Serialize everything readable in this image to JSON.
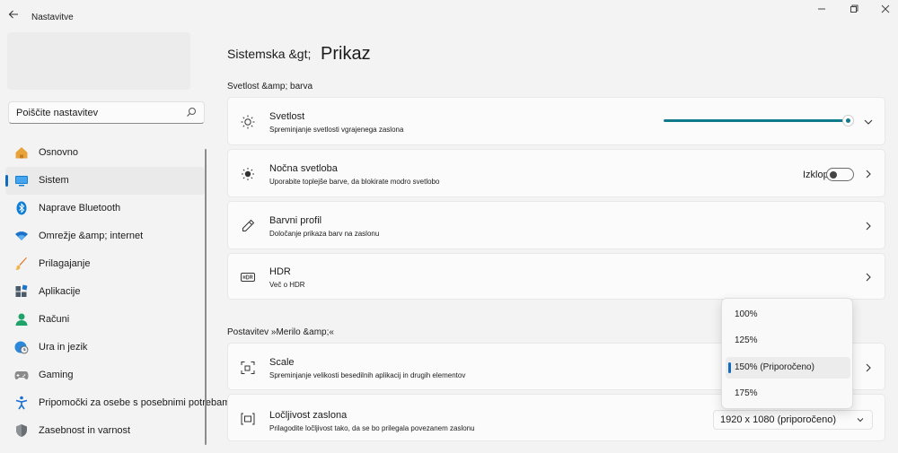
{
  "window": {
    "title": "Nastavitve",
    "back_icon": "arrow-left-icon",
    "minimize_icon": "minimize-icon",
    "maximize_icon": "restore-icon",
    "close_icon": "close-icon"
  },
  "search": {
    "placeholder": "Poiščite nastavitev",
    "icon": "search-icon"
  },
  "sidebar": {
    "items": [
      {
        "label": "Osnovno",
        "icon": "home-icon",
        "color": "#e8a33b"
      },
      {
        "label": "Sistem",
        "icon": "monitor-icon",
        "color": "#0f7fd6",
        "active": true
      },
      {
        "label": "Naprave Bluetooth",
        "icon": "bluetooth-icon",
        "color": "#0f7fd6"
      },
      {
        "label": "Omrežje &amp; internet",
        "icon": "wifi-icon",
        "color": "#1a73c9"
      },
      {
        "label": "Prilagajanje",
        "icon": "brush-icon",
        "color": "#e07b2f"
      },
      {
        "label": "Aplikacije",
        "icon": "apps-icon",
        "color": "#4a5a6a"
      },
      {
        "label": "Računi",
        "icon": "person-icon",
        "color": "#1fa36b"
      },
      {
        "label": "Ura in jezik",
        "icon": "globe-clock-icon",
        "color": "#2b88d8"
      },
      {
        "label": "Gaming",
        "icon": "gamepad-icon",
        "color": "#7a7a7a"
      },
      {
        "label": "Pripomočki za osebe s posebnimi potrebami",
        "icon": "accessibility-icon",
        "color": "#1a6fd1"
      },
      {
        "label": "Zasebnost in varnost",
        "icon": "shield-icon",
        "color": "#6b6f74"
      }
    ]
  },
  "breadcrumb": {
    "parent": "Sistemska &gt;",
    "current": "Prikaz"
  },
  "sections": {
    "brightness": "Svetlost &amp; barva",
    "scale": "Postavitev »Merilo &amp;«"
  },
  "cards": {
    "brightness": {
      "title": "Svetlost",
      "subtitle": "Spreminjanje svetlosti vgrajenega zaslona",
      "icon": "sun-icon",
      "level": 1.0
    },
    "night_light": {
      "title": "Nočna svetloba",
      "subtitle": "Uporabite toplejše barve, da blokirate modro svetlobo",
      "icon": "night-sun-icon",
      "toggle_label": "Izklop",
      "toggle_on": false
    },
    "color_profile": {
      "title": "Barvni profil",
      "subtitle": "Določanje prikaza barv na zaslonu",
      "icon": "eyedropper-icon"
    },
    "hdr": {
      "title": "HDR",
      "subtitle": "Več o HDR",
      "icon": "hdr-icon"
    },
    "scale": {
      "title": "Scale",
      "subtitle": "Spreminjanje velikosti besedilnih aplikacij in drugih elementov",
      "icon": "scale-icon"
    },
    "resolution": {
      "title": "Ločljivost zaslona",
      "subtitle": "Prilagodite ločljivost tako, da se bo prilegala povezanem zaslonu",
      "icon": "resolution-icon",
      "value": "1920 x 1080 (priporočeno)"
    }
  },
  "scale_popup": {
    "options": [
      {
        "label": "100%"
      },
      {
        "label": "125%"
      },
      {
        "label": "150% (Priporočeno)",
        "selected": true
      },
      {
        "label": "175%"
      }
    ]
  },
  "colors": {
    "accent": "#0f6cbd",
    "slider": "#0f7b8a"
  }
}
